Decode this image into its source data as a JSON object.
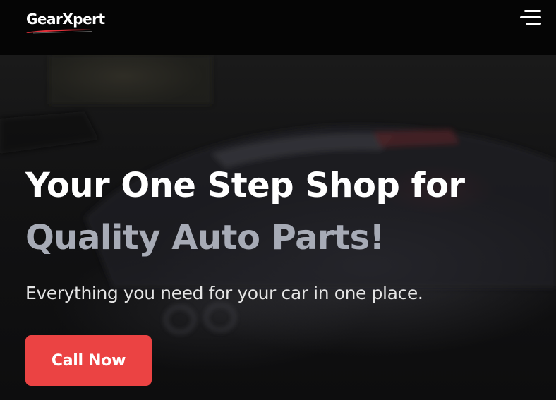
{
  "header": {
    "logo_text": "GearXpert",
    "menu_icon": "hamburger-menu-icon"
  },
  "hero": {
    "headline_line1": "Your One Step Shop for",
    "headline_line2": "Quality Auto Parts!",
    "subtitle": "Everything you need for your car in one place.",
    "cta_label": "Call Now"
  },
  "colors": {
    "background": "#050505",
    "headline_primary": "#ffffff",
    "headline_accent": "#a7abb6",
    "cta_background": "#eb4343",
    "logo_swoosh": "#e0313a"
  }
}
